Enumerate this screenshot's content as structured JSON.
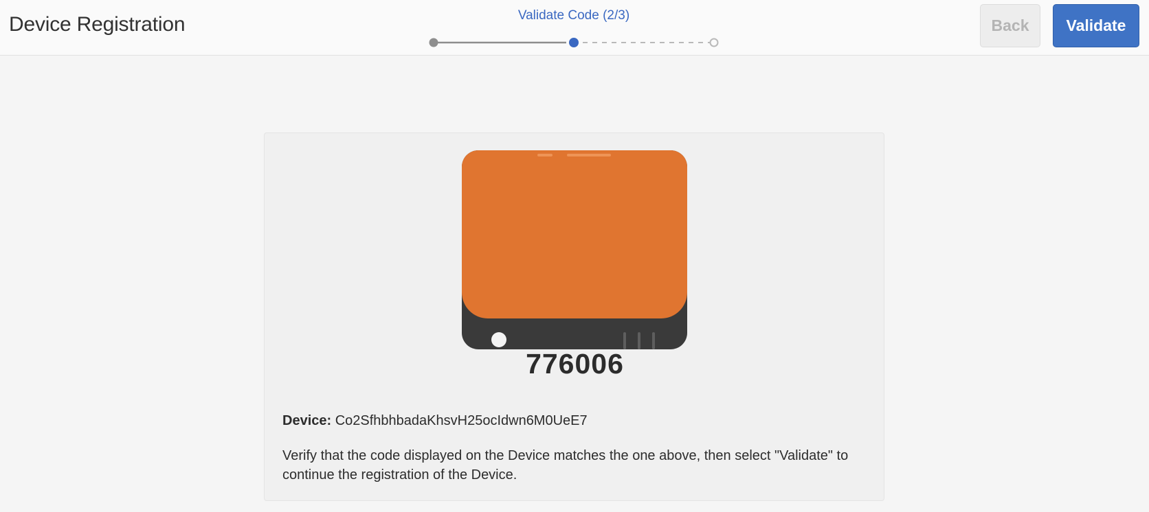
{
  "header": {
    "title": "Device Registration",
    "back_label": "Back",
    "validate_label": "Validate"
  },
  "stepper": {
    "label": "Validate Code (2/3)",
    "current_step": 2,
    "total_steps": 3
  },
  "card": {
    "code": "776006",
    "device_label": "Device:",
    "device_id": "Co2SfhbhbadaKhsvH25ocIdwn6M0UeE7",
    "instructions": "Verify that the code displayed on the Device matches the one above, then select \"Validate\" to continue the registration of the Device."
  },
  "colors": {
    "accent": "#3f73c5",
    "screen": "#e07530",
    "device_body": "#3a3a3a"
  }
}
